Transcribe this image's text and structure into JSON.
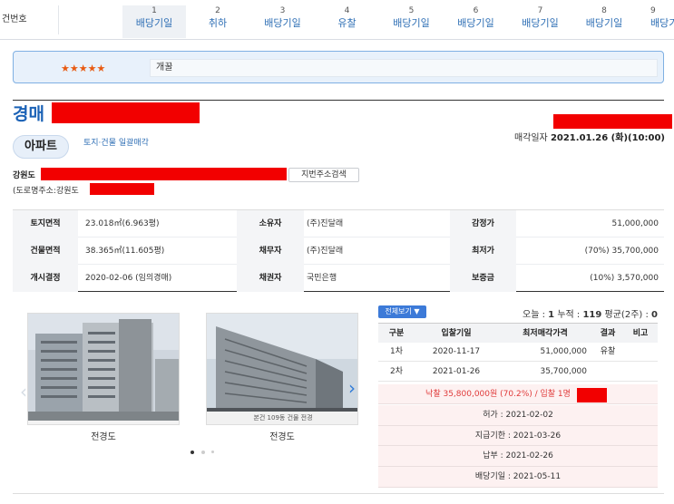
{
  "steps": {
    "case_label": "건번호",
    "items": [
      {
        "num": "1",
        "label": "배당기일"
      },
      {
        "num": "2",
        "label": "취하"
      },
      {
        "num": "3",
        "label": "배당기일"
      },
      {
        "num": "4",
        "label": "유찰"
      },
      {
        "num": "5",
        "label": "배당기일"
      },
      {
        "num": "6",
        "label": "배당기일"
      },
      {
        "num": "7",
        "label": "배당기일"
      },
      {
        "num": "8",
        "label": "배당기일"
      },
      {
        "num": "9",
        "label": "배당기"
      }
    ]
  },
  "memo": {
    "stars": "★★★★★",
    "text": "개꿀"
  },
  "header": {
    "title": "경매",
    "sale_date_label": "매각일자",
    "sale_date_value": "2021.01.26 (화)(10:00)",
    "type_pill": "아파트",
    "type_sub": "토지·건물 일괄매각",
    "address_prefix": "강원도",
    "road_prefix": "(도로명주소:강원도 ",
    "road_mid": "",
    "address_button": "지번주소검색"
  },
  "info": {
    "rows": [
      {
        "k1": "토지면적",
        "v1": "23.018㎡(6.963평)",
        "k2": "소유자",
        "v2": "(주)진달래",
        "k3": "감정가",
        "v3": "51,000,000"
      },
      {
        "k1": "건물면적",
        "v1": "38.365㎡(11.605평)",
        "k2": "채무자",
        "v2": "(주)진달래",
        "k3": "최저가",
        "v3": "(70%) 35,700,000"
      },
      {
        "k1": "개시결정",
        "v1": "2020-02-06 (임의경매)",
        "k2": "채권자",
        "v2": "국민은행",
        "k3": "보증금",
        "v3": "(10%) 3,570,000"
      }
    ]
  },
  "photos": {
    "left_caption": "전경도",
    "right_caption": "전경도",
    "right_overlay": "본건 109동 건물 전경"
  },
  "bidding": {
    "all_button": "전체보기 ▼",
    "today_label": "오늘 : ",
    "today_value": "1",
    "total_label": "누적 : ",
    "total_value": "119",
    "avg_label": "평균(2주) : ",
    "avg_value": "0",
    "headers": [
      "구분",
      "입찰기일",
      "최저매각가격",
      "결과",
      "비고"
    ],
    "rows": [
      {
        "round": "1차",
        "date": "2020-11-17",
        "price": "51,000,000",
        "result": "유찰",
        "note": ""
      },
      {
        "round": "2차",
        "date": "2021-01-26",
        "price": "35,700,000",
        "result": "",
        "note": ""
      }
    ],
    "sold": "낙찰 35,800,000원 (70.2%) / 입찰 1명",
    "permit": "허가 : 2021-02-02",
    "deadline": "지급기한 : 2021-03-26",
    "payment": "납부 : 2021-02-26",
    "dividend": "배당기일 : 2021-05-11"
  },
  "colors": {
    "accent": "#2f6fb5",
    "redact": "#f20000",
    "sold_text": "#e03a3a",
    "stars": "#e85a12"
  }
}
